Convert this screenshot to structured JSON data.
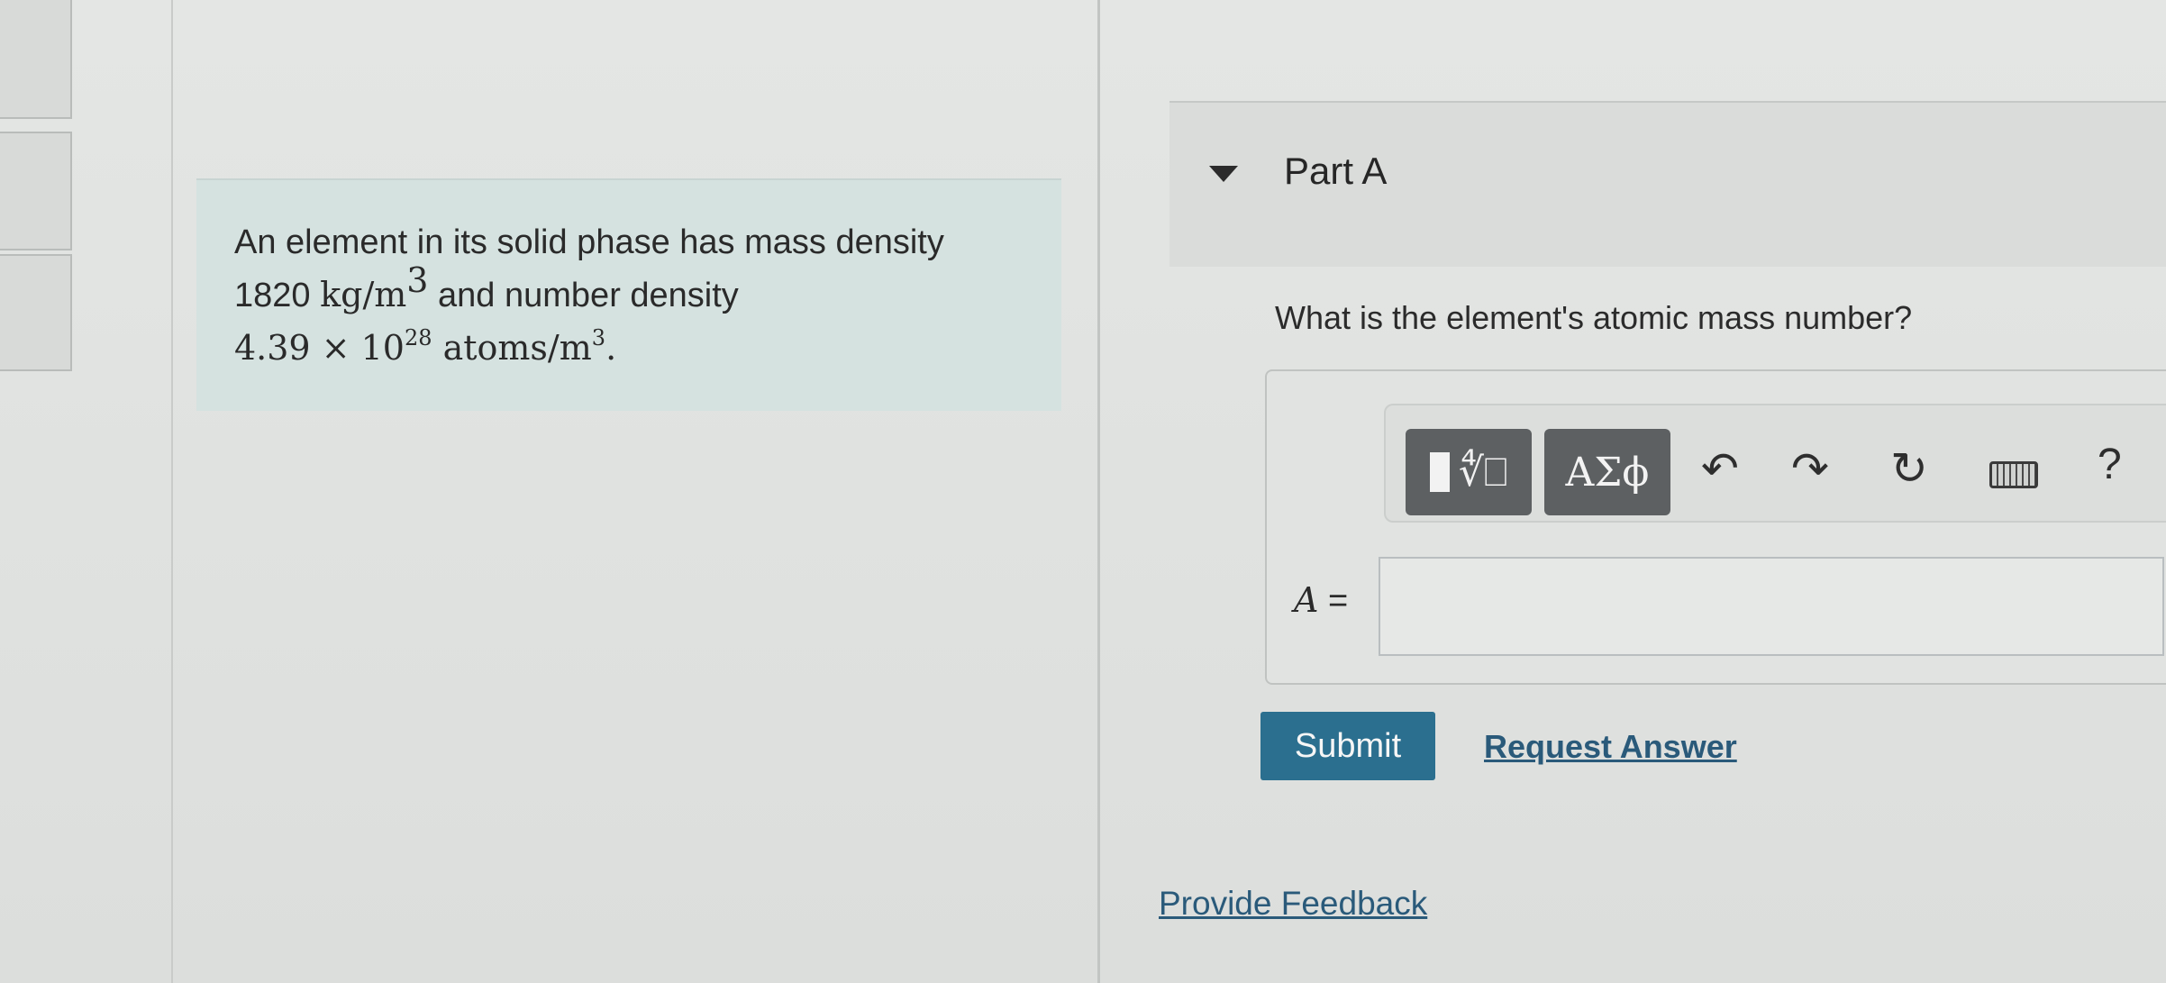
{
  "problem": {
    "line1": "An element in its solid phase has mass density",
    "mass_density_value": "1820",
    "mass_density_unit": "kg/m",
    "mass_density_exp": "3",
    "line2_suffix": " and number density",
    "number_density_coeff": "4.39 × 10",
    "number_density_exp": "28",
    "number_density_unit": " atoms/m",
    "number_density_unit_exp": "3",
    "end_punct": "."
  },
  "part": {
    "title": "Part A",
    "question": "What is the element's atomic mass number?"
  },
  "toolbar": {
    "greek_label": "ΑΣϕ",
    "undo_glyph": "↶",
    "redo_glyph": "↷",
    "reset_glyph": "↻",
    "help_label": "?",
    "icons": [
      "templates-icon",
      "greek-symbols-icon",
      "undo-icon",
      "redo-icon",
      "reset-icon",
      "keyboard-icon",
      "help-icon"
    ]
  },
  "answer": {
    "variable": "A",
    "equals": " =",
    "value": ""
  },
  "actions": {
    "submit_label": "Submit",
    "request_answer_label": "Request Answer",
    "feedback_label": "Provide Feedback"
  },
  "colors": {
    "submit_bg": "#2b6f8f",
    "link": "#2a5a7a",
    "problem_bg": "#d5e2e0"
  }
}
